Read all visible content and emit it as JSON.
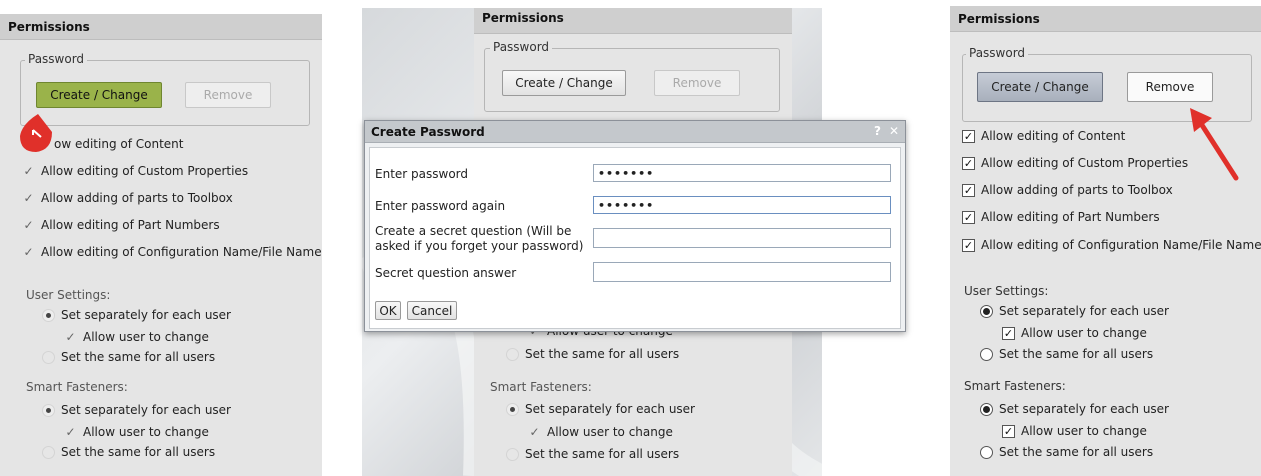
{
  "common": {
    "panel_title": "Permissions",
    "password_group": "Password",
    "create_change": "Create / Change",
    "remove": "Remove",
    "permissions": [
      "Allow editing of Content",
      "Allow editing of Custom Properties",
      "Allow adding of parts to Toolbox",
      "Allow editing of Part Numbers",
      "Allow editing of Configuration Name/File Name"
    ],
    "user_settings_label": "User Settings:",
    "smart_fasteners_label": "Smart Fasteners:",
    "set_separately": "Set separately for each user",
    "allow_user_change": "Allow user to change",
    "set_same": "Set the same for all users"
  },
  "left": {
    "perm0_partial": "ow editing of Content",
    "permissions_tail": [
      "Allow editing of Custom Properties",
      "Allow adding of parts to Toolbox",
      "Allow editing of Part Numbers",
      "Allow editing of Configuration Name/File Name"
    ]
  },
  "middle": {
    "partial_allow": "Allow user to change"
  },
  "dialog": {
    "title": "Create Password",
    "help_glyph": "?",
    "close_glyph": "✕",
    "enter_password": "Enter password",
    "enter_password_again": "Enter password again",
    "secret_question": "Create a secret question (Will be asked if you forget your password)",
    "secret_answer": "Secret question answer",
    "password_value": "•••••••",
    "password_again_value": "•••••••",
    "secret_question_value": "",
    "secret_answer_value": "",
    "ok": "OK",
    "cancel": "Cancel"
  },
  "colors": {
    "highlight_green": "#9ab34a",
    "annotation_red": "#e0302a",
    "pane_bg": "#e4e4e4",
    "header_bg": "#cdcdcd",
    "dialog_header_bg": "#c4c8cc"
  }
}
